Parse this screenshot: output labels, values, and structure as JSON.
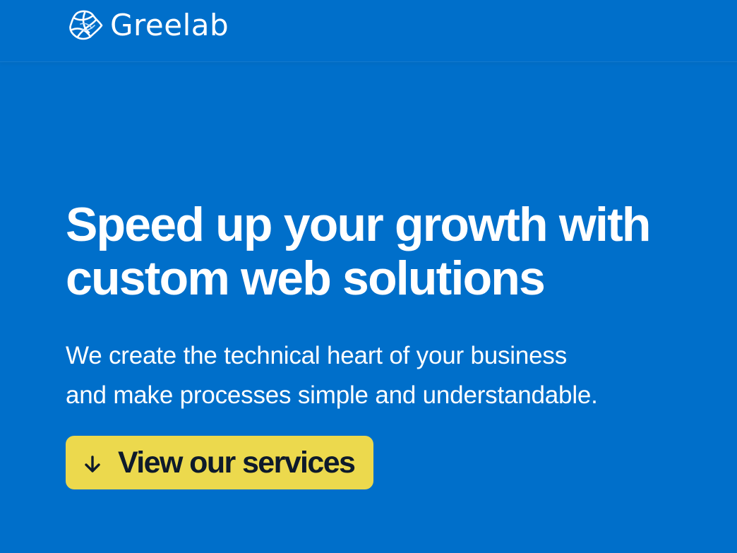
{
  "brand": {
    "name": "Greelab",
    "icon": "greelab-logo-icon"
  },
  "hero": {
    "title_line1": "Speed up your growth with",
    "title_line2": "custom web solutions",
    "subtitle_line1": "We create the technical heart of your business",
    "subtitle_line2": "and make processes simple and understandable."
  },
  "cta": {
    "label": "View our services",
    "icon": "arrow-down-icon"
  },
  "colors": {
    "background": "#006fca",
    "text": "#ffffff",
    "button_bg": "#ecd94d",
    "button_text": "#0e1a2b"
  }
}
